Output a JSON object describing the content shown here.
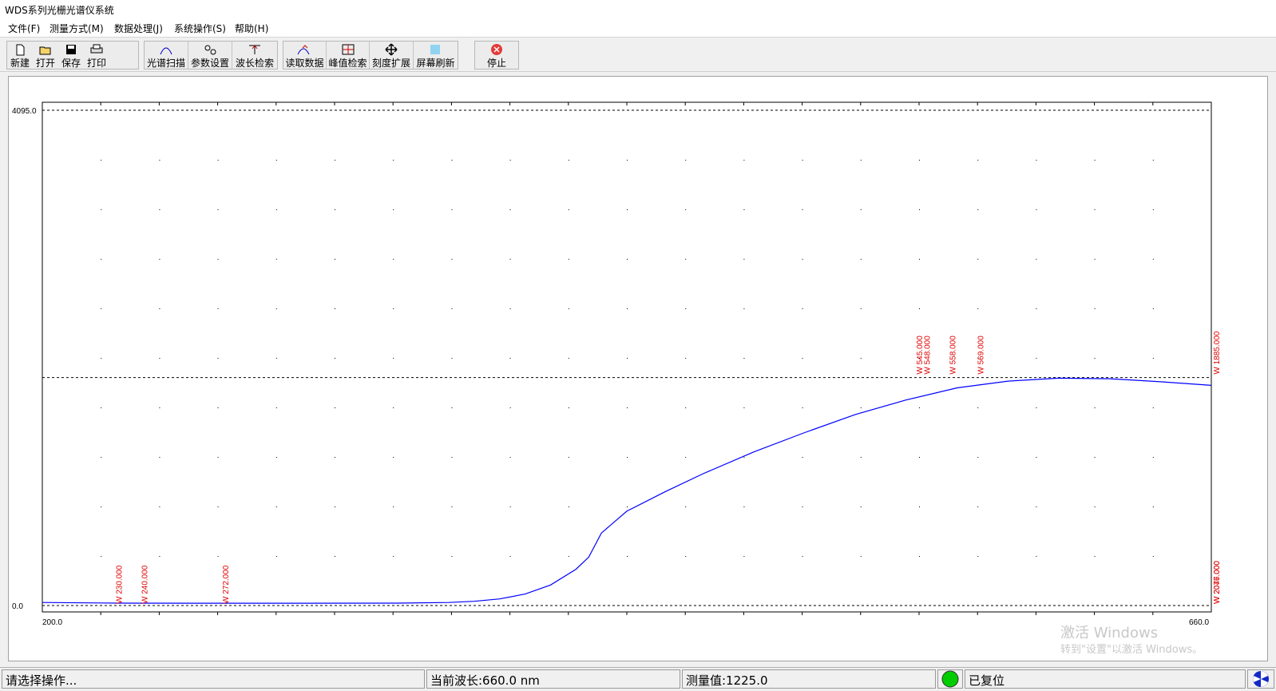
{
  "window": {
    "title": "WDS系列光栅光谱仪系统"
  },
  "menu": [
    "文件(F)",
    "测量方式(M)",
    "数据处理(J)",
    "系统操作(S)",
    "帮助(H)"
  ],
  "toolbar": {
    "file_buttons": [
      {
        "label": "新建",
        "icon": "new-file-icon"
      },
      {
        "label": "打开",
        "icon": "open-folder-icon"
      },
      {
        "label": "保存",
        "icon": "save-disk-icon"
      },
      {
        "label": "打印",
        "icon": "printer-icon"
      }
    ],
    "measure_buttons": [
      {
        "label": "光谱扫描",
        "icon": "spectrum-scan-icon"
      },
      {
        "label": "参数设置",
        "icon": "settings-icon"
      },
      {
        "label": "波长检索",
        "icon": "wavelength-search-icon"
      }
    ],
    "data_buttons": [
      {
        "label": "读取数据",
        "icon": "read-data-icon"
      },
      {
        "label": "峰值检索",
        "icon": "peak-search-icon"
      },
      {
        "label": "刻度扩展",
        "icon": "scale-expand-icon"
      },
      {
        "label": "屏幕刷新",
        "icon": "screen-refresh-icon"
      }
    ],
    "stop_button": {
      "label": "停止",
      "icon": "stop-icon"
    }
  },
  "chart_data": {
    "type": "line",
    "x_range": [
      200.0,
      660.0
    ],
    "y_range": [
      0.0,
      4095.0
    ],
    "y_ticks": [
      "4095.0",
      "0.0"
    ],
    "x_ticks": [
      "200.0",
      "660.0"
    ],
    "grid": "dotted",
    "series": [
      {
        "color": "#0000ff",
        "points": [
          [
            200,
            25
          ],
          [
            230,
            20
          ],
          [
            260,
            19
          ],
          [
            300,
            19
          ],
          [
            340,
            20
          ],
          [
            360,
            25
          ],
          [
            370,
            35
          ],
          [
            380,
            55
          ],
          [
            390,
            95
          ],
          [
            400,
            170
          ],
          [
            410,
            300
          ],
          [
            415,
            400
          ],
          [
            420,
            600
          ],
          [
            430,
            780
          ],
          [
            445,
            940
          ],
          [
            460,
            1090
          ],
          [
            480,
            1270
          ],
          [
            500,
            1430
          ],
          [
            520,
            1580
          ],
          [
            540,
            1700
          ],
          [
            560,
            1800
          ],
          [
            580,
            1855
          ],
          [
            600,
            1880
          ],
          [
            620,
            1875
          ],
          [
            640,
            1850
          ],
          [
            660,
            1820
          ]
        ]
      }
    ],
    "annotations": [
      {
        "x": 230.0,
        "y": 0,
        "text": "W 230.000"
      },
      {
        "x": 240.0,
        "y": 0,
        "text": "W 240.000"
      },
      {
        "x": 272.0,
        "y": 0,
        "text": "W 272.000"
      },
      {
        "x": 545.0,
        "y": 1885,
        "text": "W 545.000"
      },
      {
        "x": 548.0,
        "y": 1885,
        "text": "W 548.000"
      },
      {
        "x": 558.0,
        "y": 1885,
        "text": "W 558.000"
      },
      {
        "x": 569.0,
        "y": 1885,
        "text": "W 569.000"
      },
      {
        "x": 660.0,
        "y": 1885,
        "text": "W 1885.000"
      },
      {
        "x": 660.0,
        "y": 0,
        "text": "W 2076.000"
      },
      {
        "x": 660.0,
        "y": 0,
        "text": "W 2047.000"
      }
    ],
    "reference_lines": [
      1885.0
    ]
  },
  "watermark": {
    "line1": "激活 Windows",
    "line2": "转到\"设置\"以激活 Windows。"
  },
  "status": {
    "prompt": "请选择操作...",
    "wavelength": "当前波长:660.0 nm",
    "measurement": "测量值:1225.0",
    "indicator_color": "#00cc00",
    "reset_state": "已复位"
  }
}
